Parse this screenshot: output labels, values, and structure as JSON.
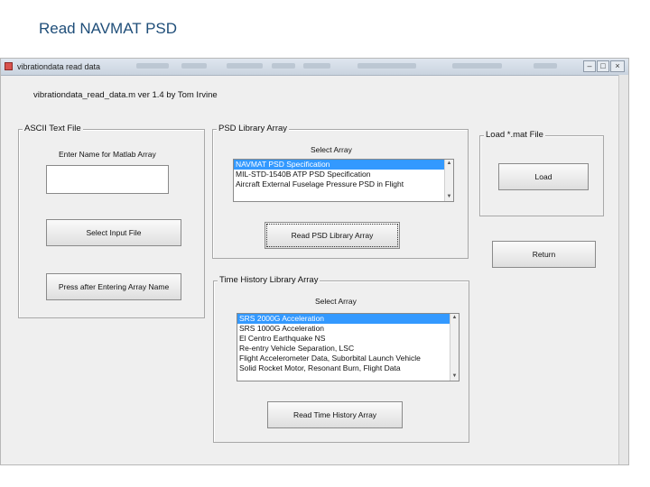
{
  "slide": {
    "title": "Read NAVMAT PSD"
  },
  "window": {
    "title": "vibrationdata read data",
    "controls": {
      "minimize": "–",
      "maximize": "□",
      "close": "×"
    }
  },
  "version_text": "vibrationdata_read_data.m ver 1.4 by Tom Irvine",
  "ascii_panel": {
    "title": "ASCII Text File",
    "name_label": "Enter Name for Matlab Array",
    "name_value": "",
    "select_button": "Select Input File",
    "press_button": "Press after Entering Array Name"
  },
  "psd_panel": {
    "title": "PSD Library Array",
    "select_label": "Select Array",
    "items": [
      "NAVMAT PSD Specification",
      "MIL-STD-1540B ATP PSD Specification",
      "Aircraft External Fuselage Pressure PSD in Flight"
    ],
    "selected_index": 0,
    "read_button": "Read PSD Library Array"
  },
  "load_panel": {
    "title": "Load *.mat File",
    "load_button": "Load"
  },
  "return_button": "Return",
  "time_panel": {
    "title": "Time History Library Array",
    "select_label": "Select Array",
    "items": [
      "SRS 2000G Acceleration",
      "SRS 1000G Acceleration",
      "El Centro Earthquake NS",
      "Re-entry Vehicle Separation, LSC",
      "Flight Accelerometer Data, Suborbital Launch Vehicle",
      "Solid Rocket Motor, Resonant Burn, Flight Data"
    ],
    "selected_index": 0,
    "read_button": "Read Time History Array"
  }
}
